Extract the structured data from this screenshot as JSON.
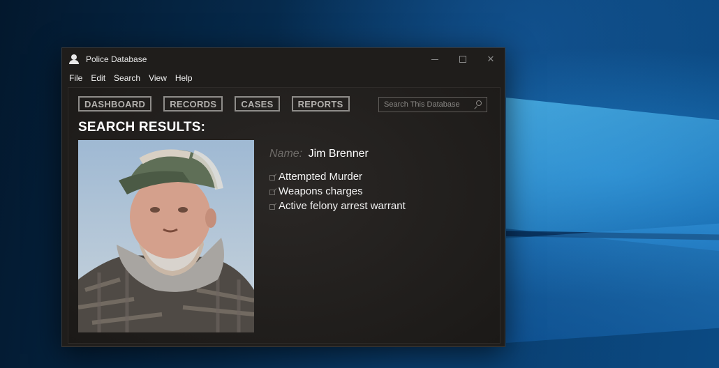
{
  "window": {
    "title": "Police Database"
  },
  "menu": [
    "File",
    "Edit",
    "Search",
    "View",
    "Help"
  ],
  "nav": {
    "dashboard": "DASHBOARD",
    "records": "RECORDS",
    "cases": "CASES",
    "reports": "REPORTS"
  },
  "search": {
    "placeholder": "Search This Database"
  },
  "results": {
    "heading": "SEARCH RESULTS:",
    "name_label": "Name:",
    "name_value": "Jim Brenner",
    "charges": [
      "Attempted Murder",
      "Weapons charges",
      "Active felony arrest warrant"
    ]
  },
  "colors": {
    "window_bg": "#1f1d1b",
    "nav_border": "#8f8d8a",
    "text": "#ffffff",
    "muted": "#6f6c69"
  }
}
